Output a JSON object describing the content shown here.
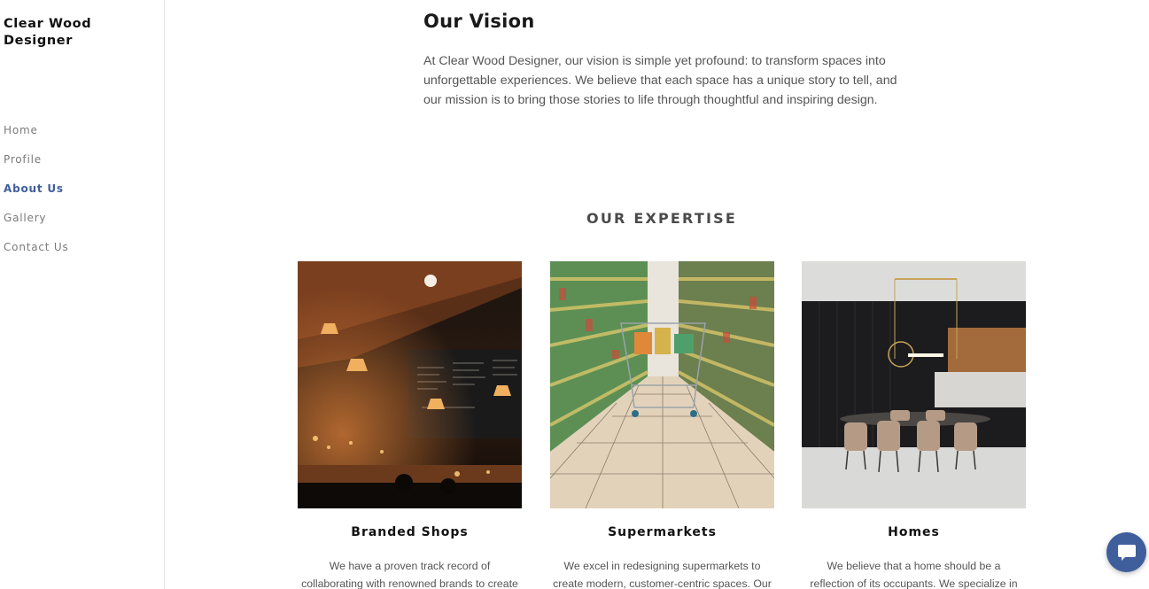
{
  "sidebar": {
    "brand": "Clear Wood Designer",
    "nav": [
      {
        "label": "Home"
      },
      {
        "label": "Profile"
      },
      {
        "label": "About Us",
        "active": true
      },
      {
        "label": "Gallery"
      },
      {
        "label": "Contact Us"
      }
    ]
  },
  "vision": {
    "title": "Our Vision",
    "text": " At Clear Wood Designer, our vision is simple yet profound: to transform spaces into unforgettable experiences. We believe that each space has a unique story to tell, and our mission is to bring those stories to life through thoughtful and inspiring design."
  },
  "expertise": {
    "title": "OUR EXPERTISE",
    "cards": [
      {
        "title": "Branded Shops",
        "text": "We have a proven track record of collaborating with renowned brands to create retail spaces",
        "image_icon": "cafe-bar-photo"
      },
      {
        "title": "Supermarkets",
        "text": "We excel in redesigning supermarkets to create modern, customer-centric spaces. Our",
        "image_icon": "supermarket-aisle-photo"
      },
      {
        "title": "Homes",
        "text": "We believe that a home should be a reflection of its occupants. We specialize in crafting",
        "image_icon": "dining-room-photo"
      }
    ]
  },
  "chat": {
    "icon": "chat-bubble-icon"
  },
  "colors": {
    "accent": "#3f5e9c",
    "nav_text": "#7a7a7a",
    "body_text": "#555555"
  }
}
